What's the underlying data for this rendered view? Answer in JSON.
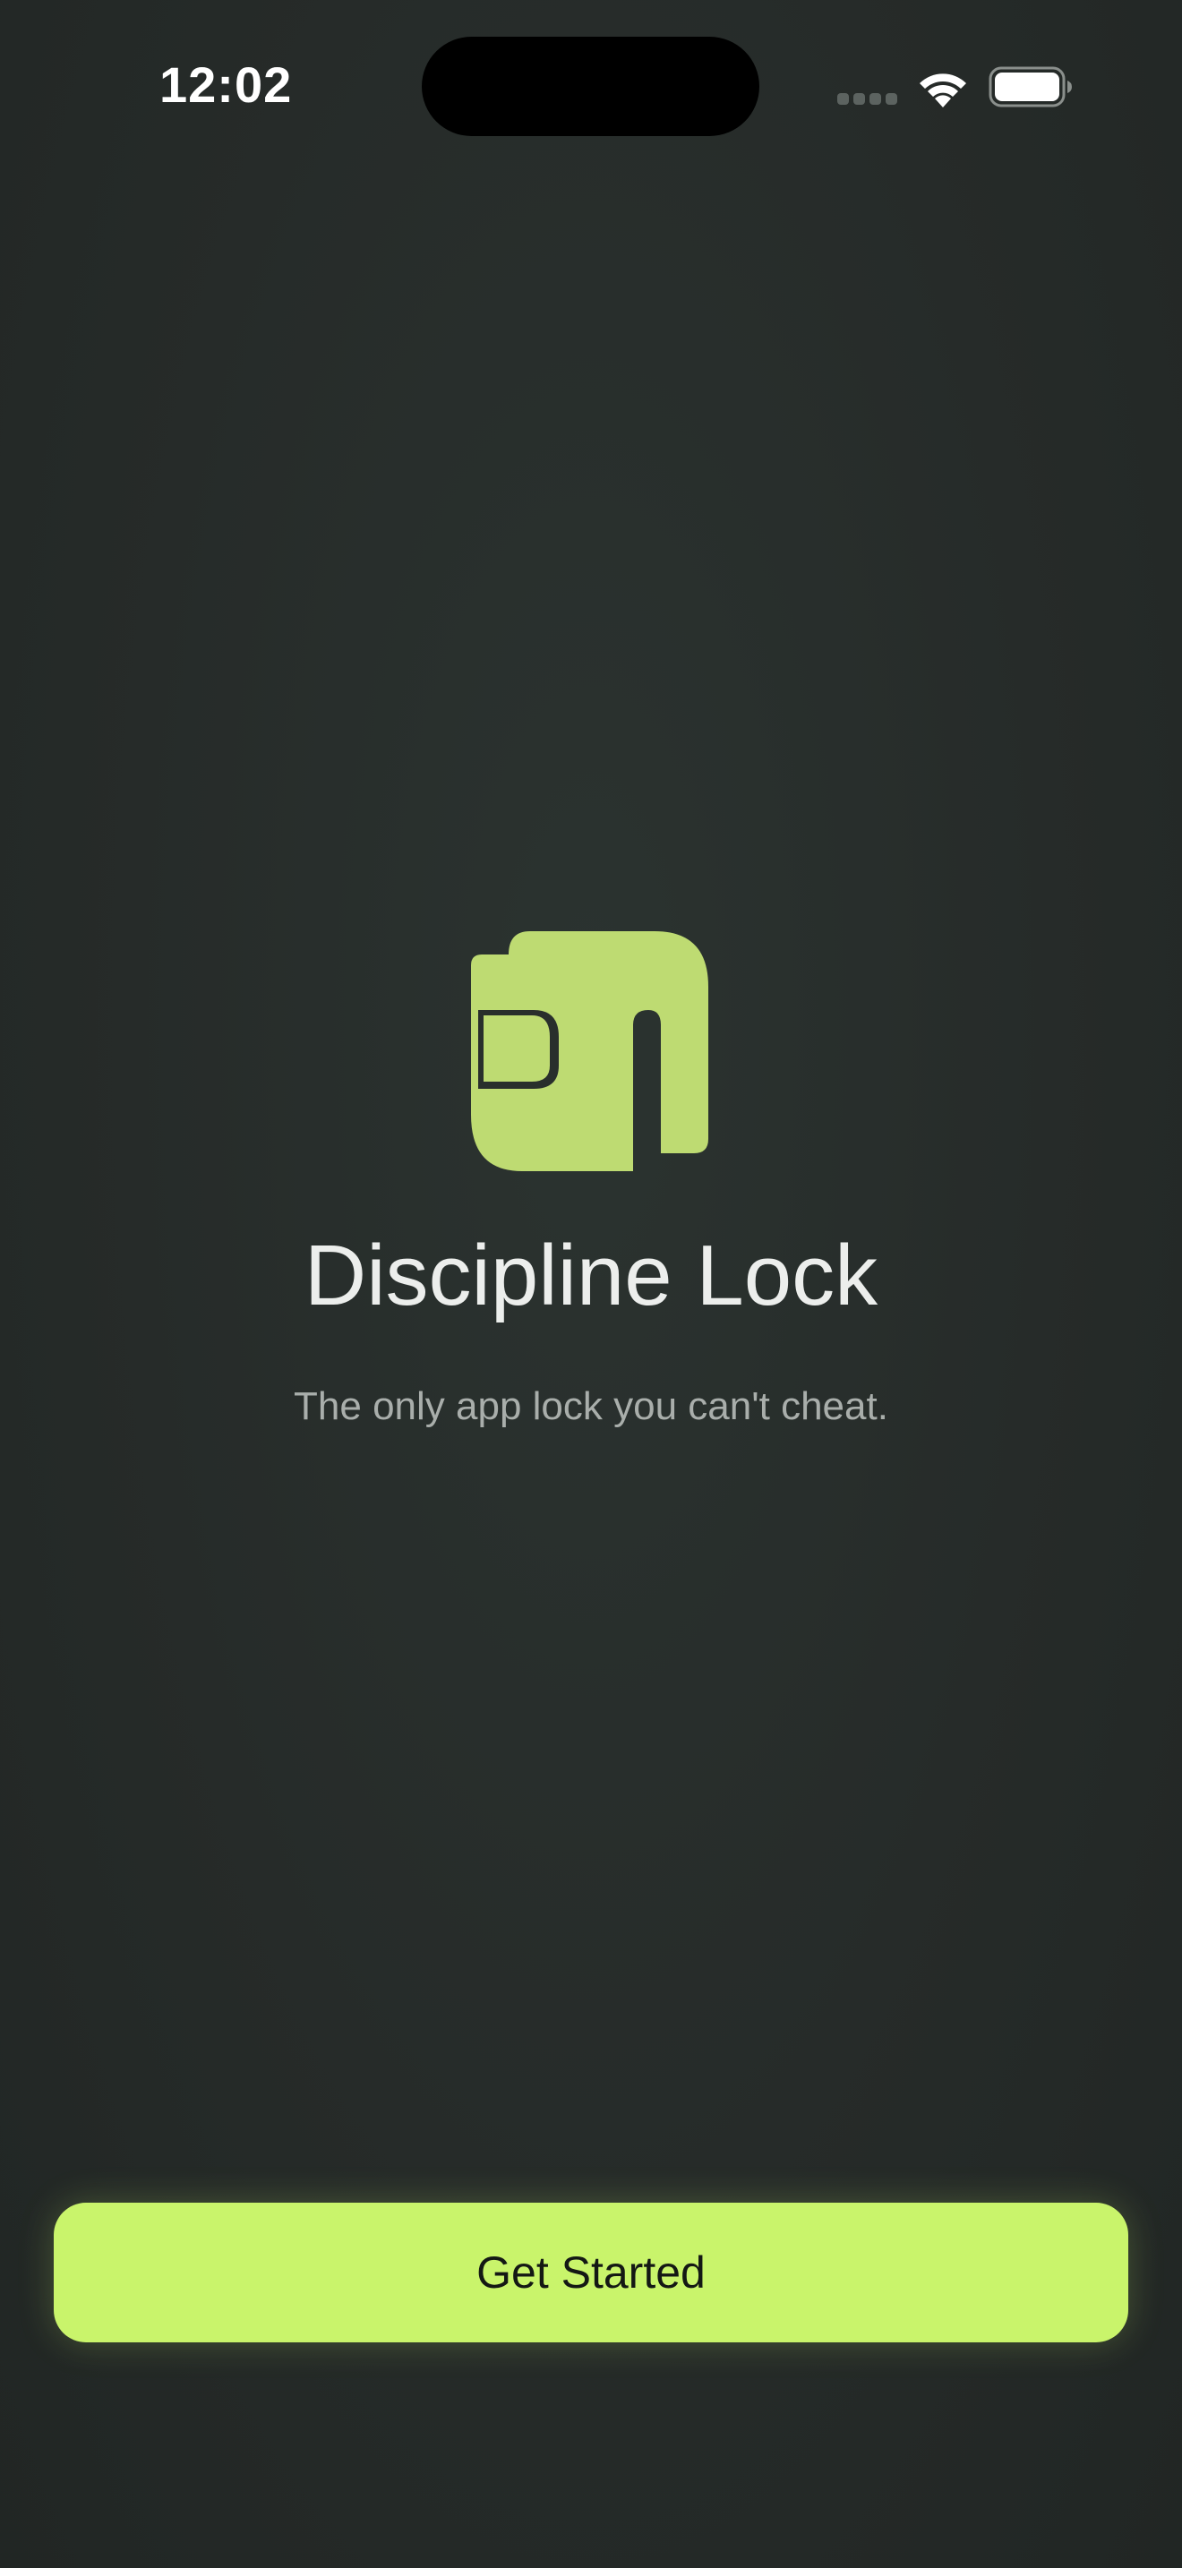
{
  "status_bar": {
    "time": "12:02",
    "signal_icon": "cellular-signal-icon",
    "wifi_icon": "wifi-icon",
    "battery_icon": "battery-icon"
  },
  "logo": {
    "icon": "discipline-lock-logo-icon",
    "color": "#bedb72"
  },
  "app": {
    "title": "Discipline Lock",
    "tagline": "The only app lock you can't cheat."
  },
  "actions": {
    "get_started_label": "Get Started",
    "button_color": "#c9f46b"
  },
  "colors": {
    "background": "#252a28",
    "accent": "#c9f46b"
  }
}
